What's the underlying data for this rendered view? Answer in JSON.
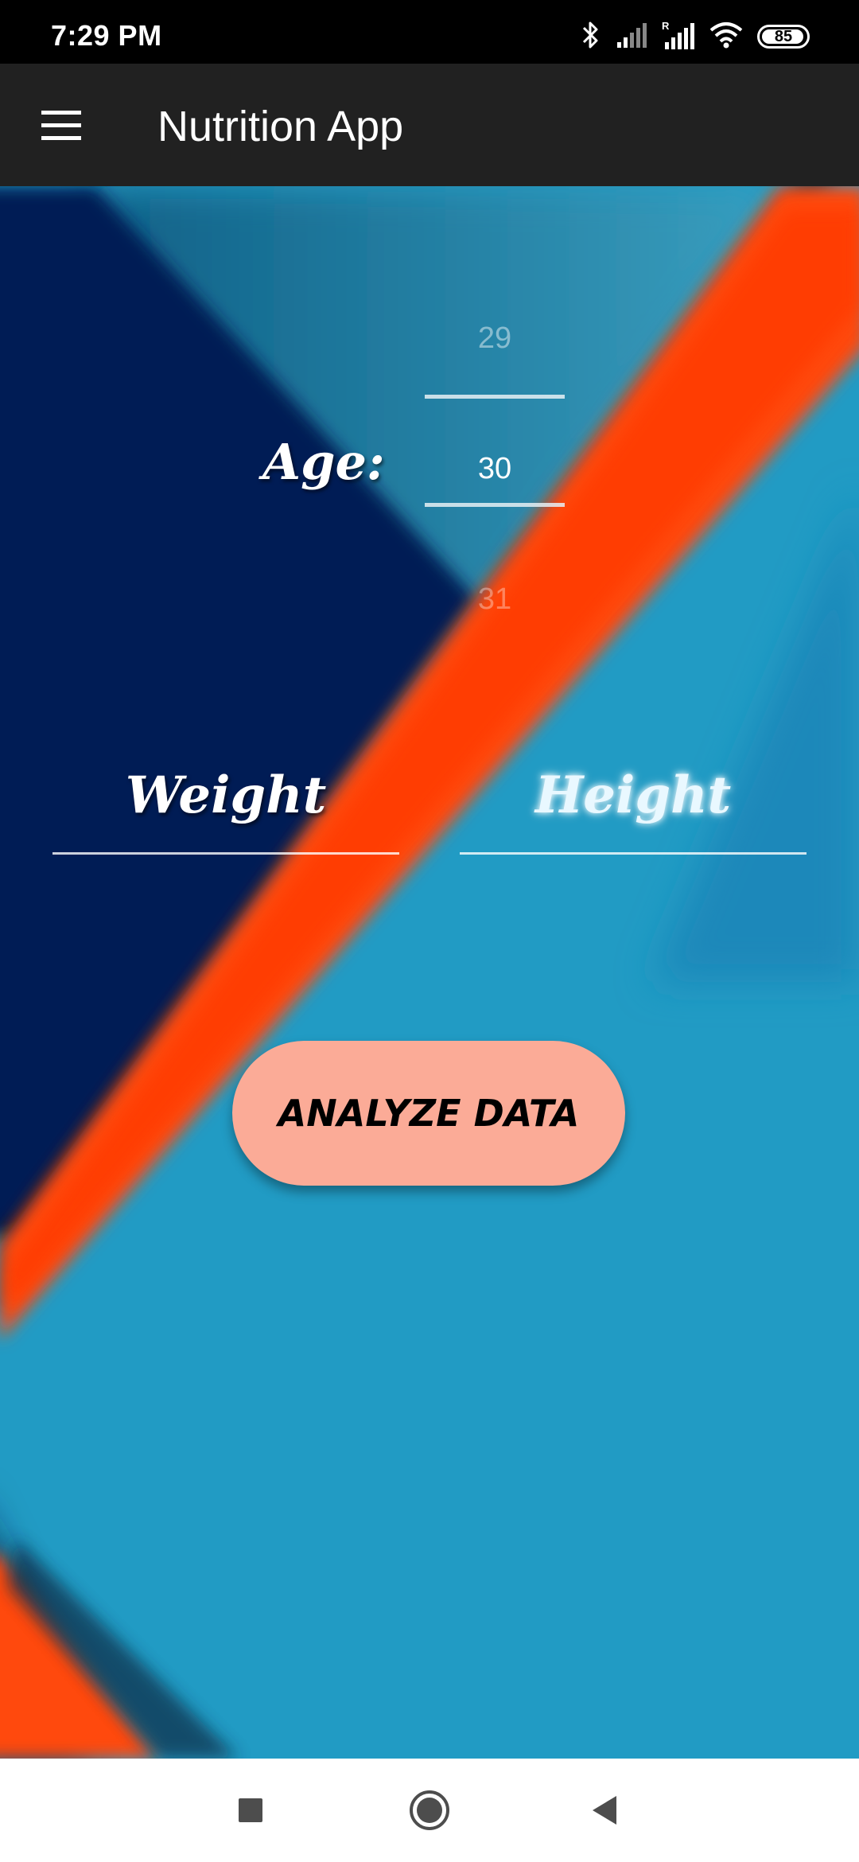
{
  "status_bar": {
    "time": "7:29 PM",
    "battery_level": "85",
    "icons": [
      "bluetooth-icon",
      "signal-weak-icon",
      "signal-roaming-icon",
      "wifi-icon",
      "battery-icon"
    ]
  },
  "app_bar": {
    "title": "Nutrition App",
    "menu_icon": "hamburger-menu-icon"
  },
  "form": {
    "age_label": "Age:",
    "age_picker": {
      "previous": "29",
      "selected": "30",
      "next": "31"
    },
    "weight_hint": "Weight",
    "height_hint": "Height",
    "analyze_button": "ANALYZE DATA"
  },
  "nav_bar": {
    "recents_icon": "square-recents-icon",
    "home_icon": "circle-home-icon",
    "back_icon": "triangle-back-icon"
  },
  "colors": {
    "app_bar": "#212121",
    "background_blue": "#219bc4",
    "dark_navy": "#001a55",
    "orange": "#ff4a10",
    "button": "#fbab97"
  }
}
